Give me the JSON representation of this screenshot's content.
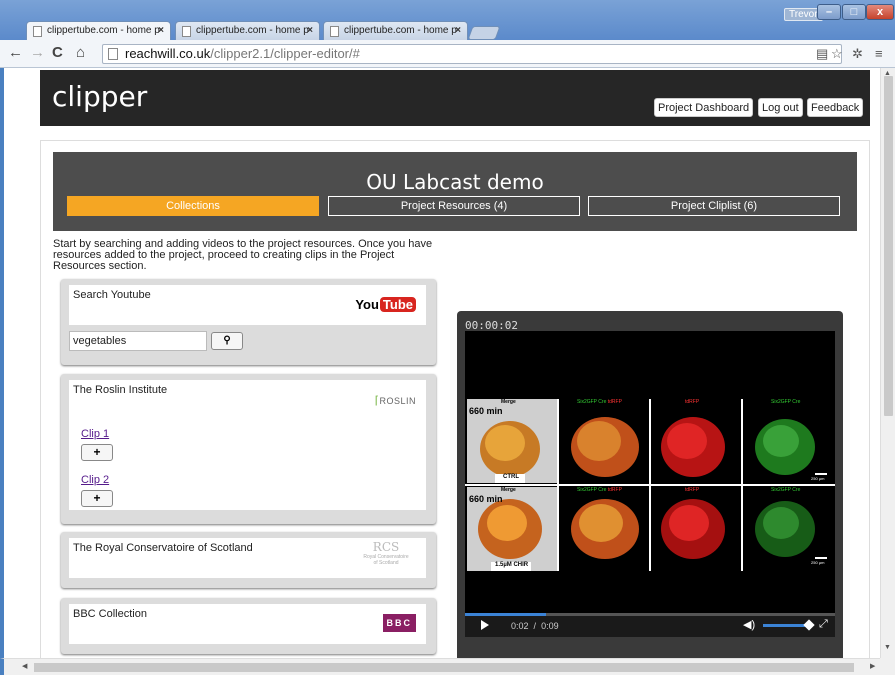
{
  "browser": {
    "tabs": [
      {
        "title": "clippertube.com - home p",
        "active": true
      },
      {
        "title": "clippertube.com - home p",
        "active": false
      },
      {
        "title": "clippertube.com - home p",
        "active": false
      }
    ],
    "user": "Trevor",
    "url_domain": "reachwill.co.uk",
    "url_path": "/clipper2.1/clipper-editor/#"
  },
  "site": {
    "logo": "clipper",
    "header_buttons": [
      "Project Dashboard",
      "Log out",
      "Feedback"
    ]
  },
  "project": {
    "title": "OU Labcast demo",
    "tabs": [
      {
        "label": "Collections",
        "active": true
      },
      {
        "label": "Project Resources (4)",
        "active": false
      },
      {
        "label": "Project Cliplist (6)",
        "active": false
      }
    ],
    "intro_lines": [
      "Start by searching and adding videos to the project resources. Once you have",
      "resources added to the project, proceed to creating clips in the Project",
      "Resources section."
    ]
  },
  "collections": {
    "youtube": {
      "name": "Search Youtube",
      "logo_you": "You",
      "logo_tube": "Tube",
      "search_value": "vegetables"
    },
    "roslin": {
      "name": "The Roslin Institute",
      "logo": "ROSLIN",
      "clips": [
        "Clip 1",
        "Clip 2"
      ],
      "add_label": "+"
    },
    "rcs": {
      "name": "The Royal Conservatoire of Scotland",
      "logo_mark": "RCS",
      "logo_line1": "Royal Conservatoire",
      "logo_line2": "of Scotland"
    },
    "bbc": {
      "name": "BBC Collection",
      "logo": "BBC"
    }
  },
  "video": {
    "timecode": "00:00:02",
    "current": "0:02",
    "separator": "/",
    "duration": "0:09",
    "progress_fraction": 0.22,
    "volume_fraction": 0.9,
    "panel_labels": {
      "merge": "Merge",
      "ch_green_red": "Six2GFP Cre",
      "ch_red": "tdRFP",
      "ch_green": "Six2GFP Cre",
      "time_top": "660 min",
      "time_bottom": "660 min",
      "ctrl": "CTRL",
      "chir": "1.5µM CHIR",
      "scale": "250 µm"
    }
  }
}
